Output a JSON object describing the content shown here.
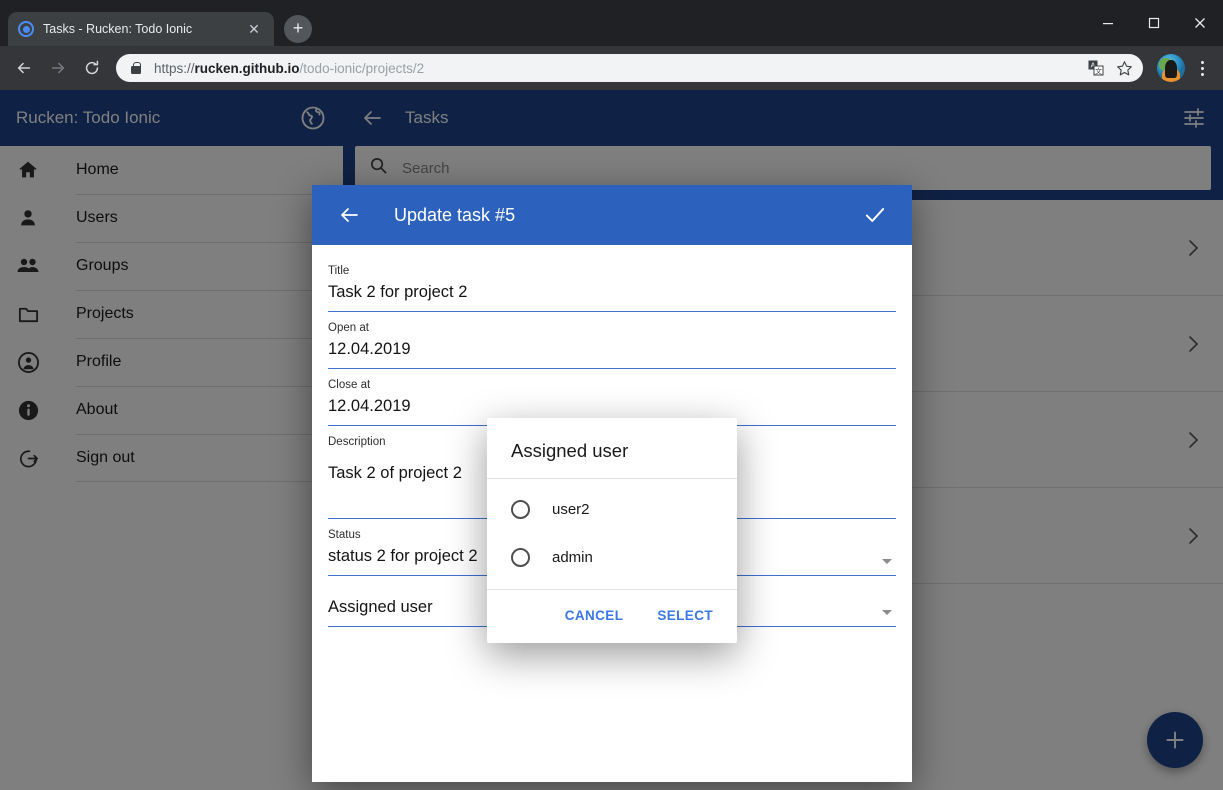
{
  "browser": {
    "tab": {
      "title": "Tasks - Rucken: Todo Ionic",
      "favicon": "ionic-logo-icon",
      "close_label": "✕",
      "new_tab_label": "+"
    },
    "window_controls": {
      "minimize": "minimize-icon",
      "maximize": "maximize-icon",
      "close": "close-icon"
    },
    "nav": {
      "back": "back-arrow-icon",
      "forward": "forward-arrow-icon",
      "reload": "reload-icon"
    },
    "omnibox": {
      "lock": "lock-icon",
      "scheme": "https://",
      "host": "rucken.github.io",
      "path": "/todo-ionic/projects/2",
      "translate": "translate-icon",
      "bookmark": "star-icon",
      "profile": "profile-avatar",
      "menu": "kebab-menu-icon"
    }
  },
  "sidemenu": {
    "title": "Rucken: Todo Ionic",
    "language_icon": "globe-icon",
    "items": [
      {
        "label": "Home",
        "icon": "home-icon"
      },
      {
        "label": "Users",
        "icon": "person-icon"
      },
      {
        "label": "Groups",
        "icon": "people-icon"
      },
      {
        "label": "Projects",
        "icon": "folder-icon"
      },
      {
        "label": "Profile",
        "icon": "account-circle-icon"
      },
      {
        "label": "About",
        "icon": "info-icon"
      },
      {
        "label": "Sign out",
        "icon": "logout-icon"
      }
    ]
  },
  "main": {
    "toolbar": {
      "back": "back-arrow-icon",
      "title": "Tasks",
      "filter": "tune-icon"
    },
    "search": {
      "icon": "search-icon",
      "value": "",
      "placeholder": "Search"
    },
    "rows": [
      {
        "chevron": "chevron-right-icon"
      },
      {
        "chevron": "chevron-right-icon"
      },
      {
        "chevron": "chevron-right-icon"
      },
      {
        "chevron": "chevron-right-icon"
      }
    ],
    "fab": {
      "label": "+",
      "icon": "add-icon"
    }
  },
  "task_modal": {
    "toolbar": {
      "back": "back-arrow-icon",
      "title": "Update task #5",
      "submit": "check-icon"
    },
    "fields": {
      "title": {
        "label": "Title",
        "value": "Task 2 for project 2"
      },
      "open_at": {
        "label": "Open at",
        "value": "12.04.2019"
      },
      "close_at": {
        "label": "Close at",
        "value": "12.04.2019"
      },
      "description": {
        "label": "Description",
        "value": "Task 2 of project 2"
      },
      "status": {
        "label": "Status",
        "value": "status 2 for project 2"
      },
      "assigned_user": {
        "label": "Assigned user",
        "value": ""
      }
    }
  },
  "alert_dialog": {
    "title": "Assigned user",
    "options": [
      {
        "label": "user2",
        "selected": false
      },
      {
        "label": "admin",
        "selected": false
      }
    ],
    "cancel_label": "CANCEL",
    "select_label": "SELECT"
  },
  "colors": {
    "brand_blue": "#1e4388",
    "modal_blue": "#2c62be",
    "accent_link": "#3b78e7",
    "field_underline": "#3f6fd0",
    "backdrop": "rgba(0,0,0,0.5)"
  }
}
